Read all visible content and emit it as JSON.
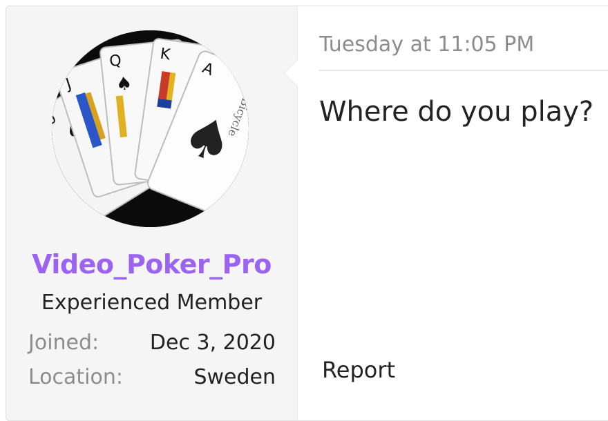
{
  "user": {
    "username": "Video_Poker_Pro",
    "title": "Experienced Member",
    "joined_label": "Joined:",
    "joined_value": "Dec 3, 2020",
    "location_label": "Location:",
    "location_value": "Sweden",
    "username_color": "#9b63f2"
  },
  "post": {
    "timestamp": "Tuesday at 11:05 PM",
    "message": "Where do you play?",
    "report_label": "Report"
  }
}
